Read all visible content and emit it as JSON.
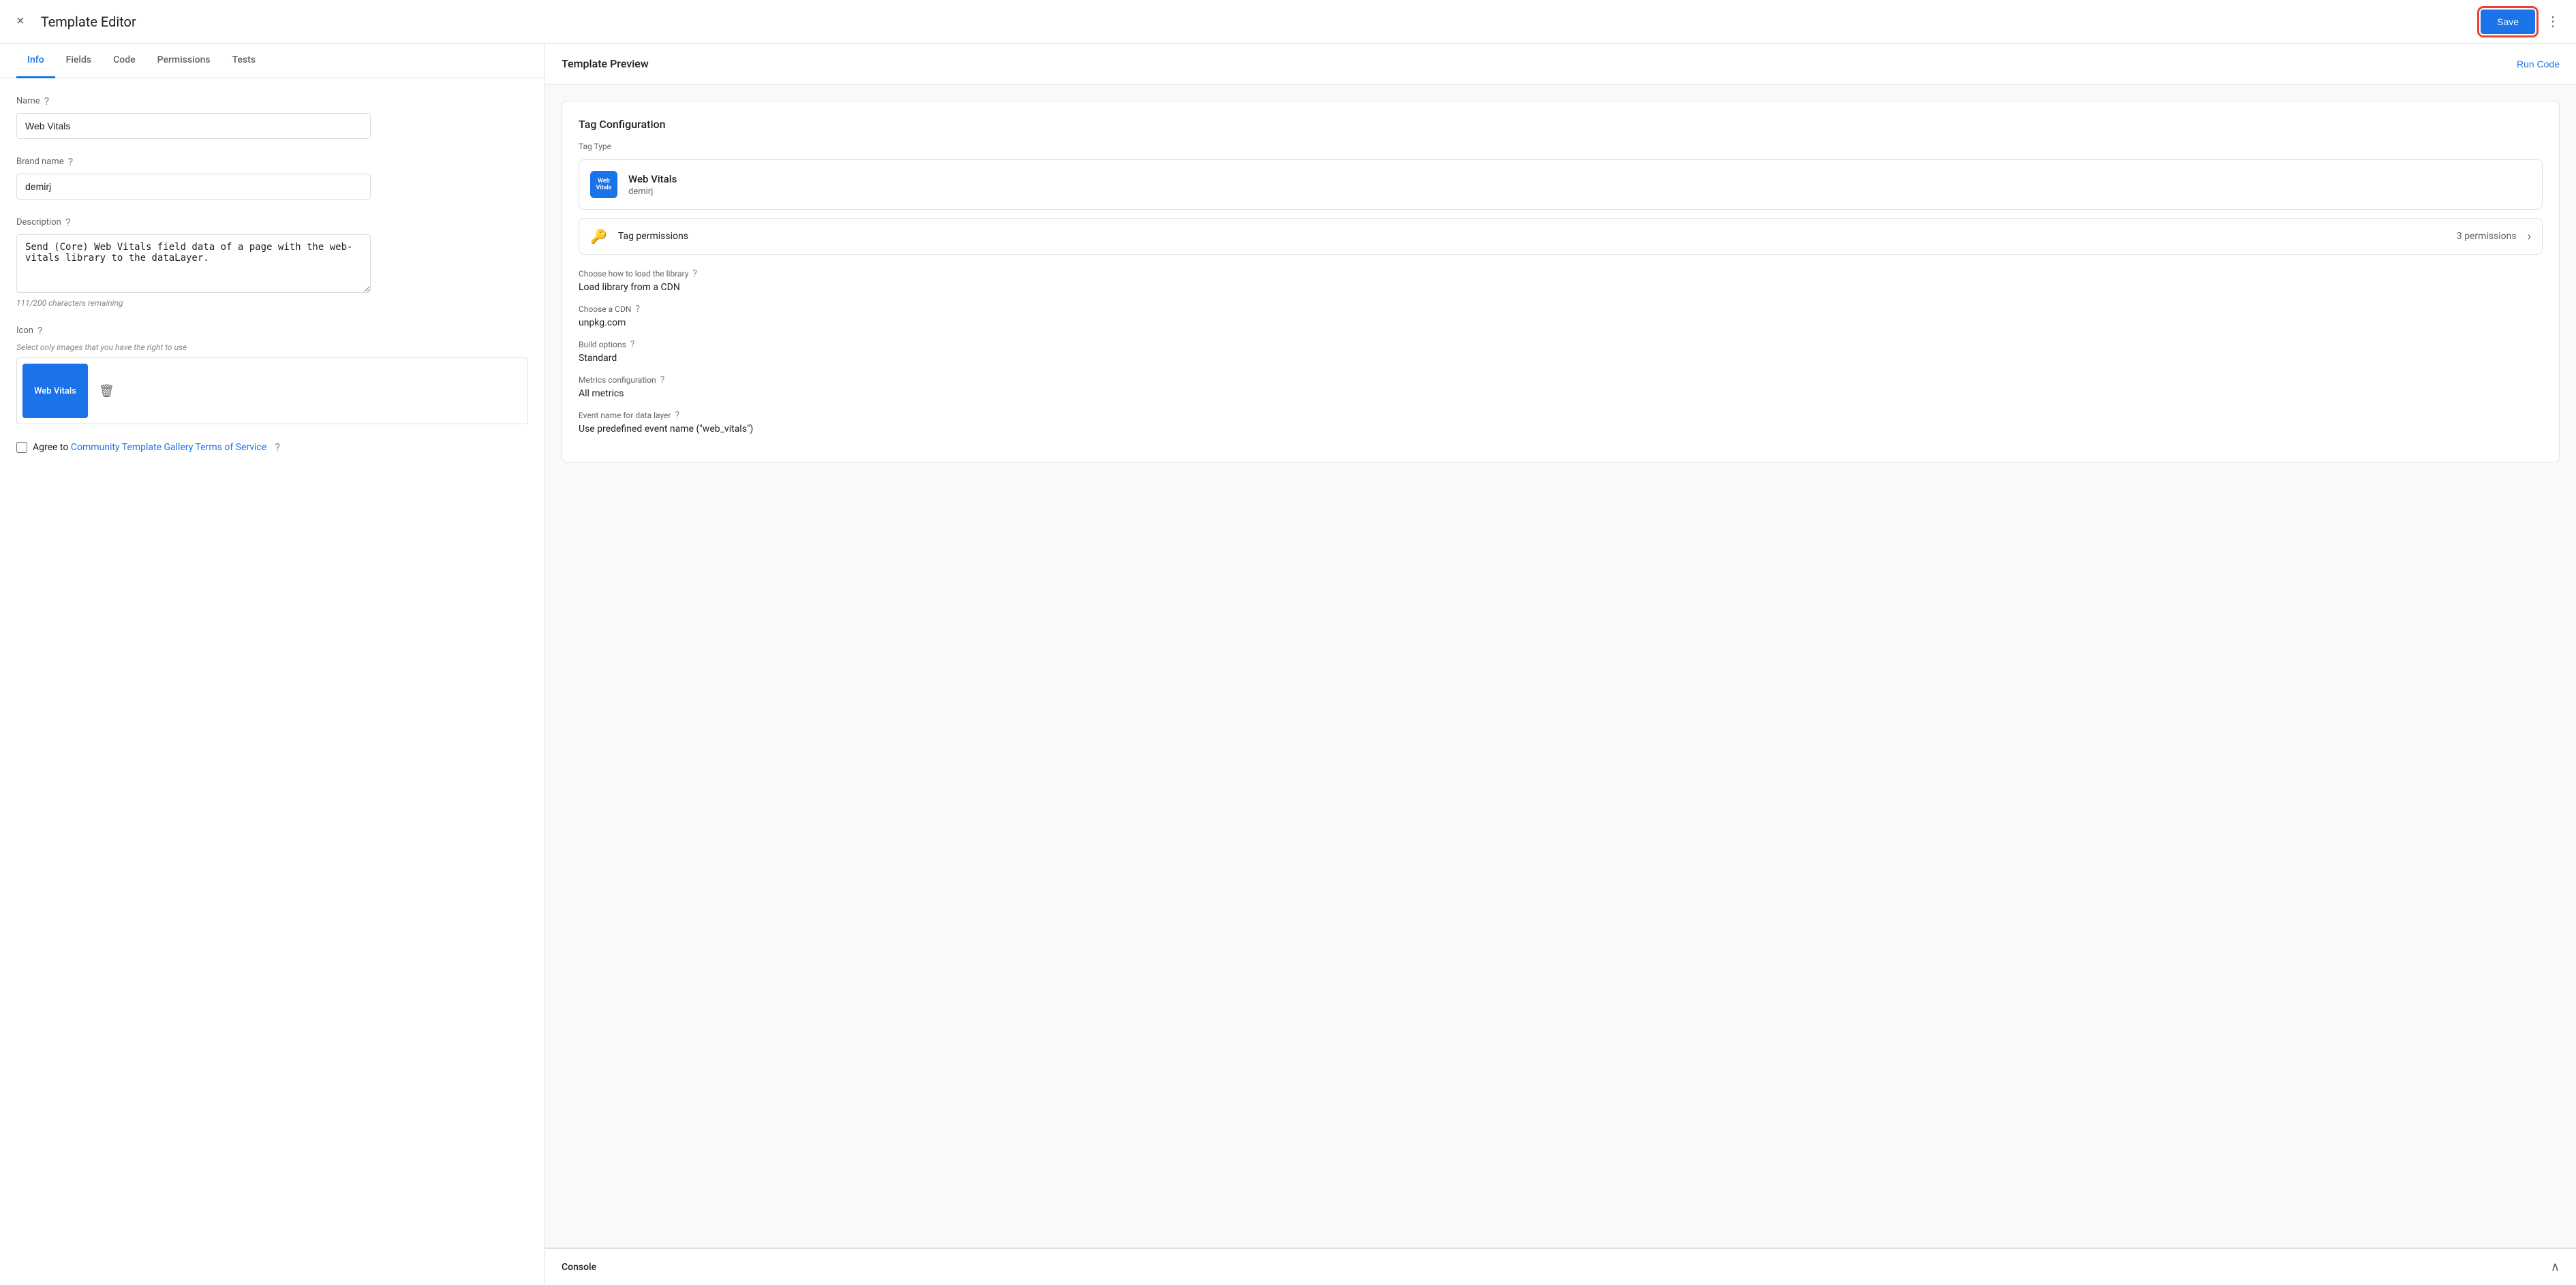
{
  "header": {
    "title": "Template Editor",
    "save_label": "Save",
    "close_icon": "×",
    "more_icon": "⋮"
  },
  "tabs": [
    {
      "id": "info",
      "label": "Info",
      "active": true
    },
    {
      "id": "fields",
      "label": "Fields",
      "active": false
    },
    {
      "id": "code",
      "label": "Code",
      "active": false
    },
    {
      "id": "permissions",
      "label": "Permissions",
      "active": false
    },
    {
      "id": "tests",
      "label": "Tests",
      "active": false
    }
  ],
  "form": {
    "name_label": "Name",
    "name_value": "Web Vitals",
    "brand_label": "Brand name",
    "brand_value": "demirj",
    "description_label": "Description",
    "description_value": "Send (Core) Web Vitals field data of a page with the web-vitals library to the dataLayer.",
    "char_count": "111/200 characters remaining",
    "icon_label": "Icon",
    "icon_note": "Select only images that you have the right to use",
    "icon_text": "Web Vitals",
    "agree_text": "Agree to",
    "agree_link": "Community Template Gallery Terms of Service"
  },
  "preview": {
    "title": "Template Preview",
    "run_code_label": "Run Code",
    "tag_config": {
      "title": "Tag Configuration",
      "tag_type_label": "Tag Type",
      "tag_name": "Web Vitals",
      "tag_sub": "demirj",
      "permissions_label": "Tag permissions",
      "permissions_count": "3 permissions",
      "load_library_label": "Choose how to load the library",
      "load_library_value": "Load library from a CDN",
      "cdn_label": "Choose a CDN",
      "cdn_value": "unpkg.com",
      "build_label": "Build options",
      "build_value": "Standard",
      "metrics_label": "Metrics configuration",
      "metrics_value": "All metrics",
      "event_label": "Event name for data layer",
      "event_value": "Use predefined event name (\"web_vitals\")"
    },
    "console": {
      "title": "Console",
      "chevron": "∧"
    }
  }
}
